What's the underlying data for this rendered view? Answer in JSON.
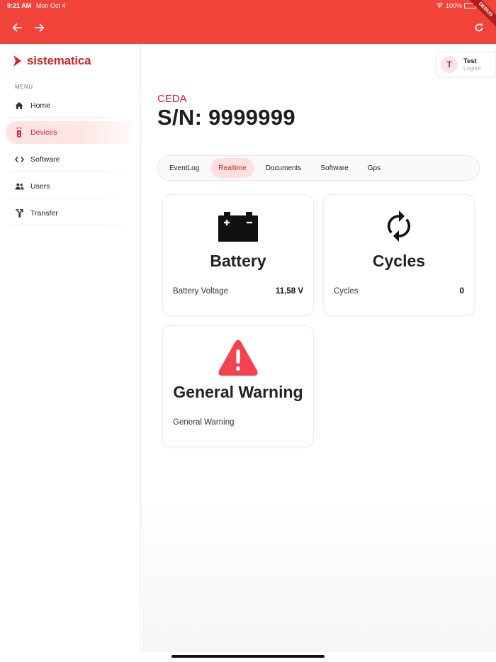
{
  "status_bar": {
    "time": "9:21 AM",
    "date": "Mon Oct 4",
    "battery": "100%"
  },
  "debug_label": "DEBUG",
  "brand": {
    "name": "sistematica",
    "color": "#d3232b"
  },
  "topbar_color": "#f2433a",
  "sidebar": {
    "menu_caption": "MENU",
    "items": [
      {
        "label": "Home",
        "icon": "home-icon",
        "active": false
      },
      {
        "label": "Devices",
        "icon": "remote-icon",
        "active": true
      },
      {
        "label": "Software",
        "icon": "code-icon",
        "active": false
      },
      {
        "label": "Users",
        "icon": "users-icon",
        "active": false
      },
      {
        "label": "Transfer",
        "icon": "transfer-icon",
        "active": false
      }
    ]
  },
  "user": {
    "initial": "T",
    "name": "Test",
    "logout": "Logout"
  },
  "device": {
    "model": "CEDA",
    "serial": "S/N: 9999999"
  },
  "tabs": [
    {
      "label": "EventLog",
      "active": false
    },
    {
      "label": "Realtime",
      "active": true
    },
    {
      "label": "Documents",
      "active": false
    },
    {
      "label": "Software",
      "active": false
    },
    {
      "label": "Gps",
      "active": false
    }
  ],
  "cards": {
    "battery": {
      "title": "Battery",
      "icon": "battery-icon",
      "label": "Battery Voltage",
      "value": "11,58 V"
    },
    "cycles": {
      "title": "Cycles",
      "icon": "sync-icon",
      "label": "Cycles",
      "value": "0"
    },
    "warning": {
      "title": "General Warning",
      "icon": "warning-icon",
      "label": "General Warning",
      "icon_color": "#f5424f"
    }
  }
}
